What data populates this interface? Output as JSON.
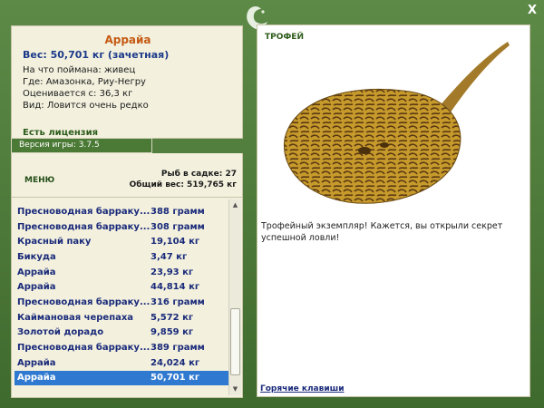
{
  "window": {
    "close_label": "X"
  },
  "fish": {
    "name": "Аррайа",
    "weight_line": "Вес: 50,701 кг (зачетная)",
    "caught_on": "На что поймана: живец",
    "location": "Где: Амазонка, Риу-Негру",
    "valued_from": "Оценивается с: 36,3 кг",
    "rarity": "Вид: Ловится очень редко"
  },
  "license": "Есть лицензия",
  "version": "Версия игры: 3.7.5",
  "menu_label": "МЕНЮ",
  "cage": {
    "count": "Рыб в садке: 27",
    "total_weight": "Общий вес: 519,765 кг"
  },
  "catch_list": [
    {
      "name": "Пресноводная барраку...",
      "weight": "388 грамм"
    },
    {
      "name": "Пресноводная барраку...",
      "weight": "308 грамм"
    },
    {
      "name": "Красный паку",
      "weight": "19,104 кг"
    },
    {
      "name": "Бикуда",
      "weight": "3,47 кг"
    },
    {
      "name": "Аррайа",
      "weight": "23,93 кг"
    },
    {
      "name": "Аррайа",
      "weight": "44,814 кг"
    },
    {
      "name": "Пресноводная барраку...",
      "weight": "316 грамм"
    },
    {
      "name": "Каймановая черепаха",
      "weight": "5,572 кг"
    },
    {
      "name": "Золотой дорадо",
      "weight": "9,859 кг"
    },
    {
      "name": "Пресноводная барраку...",
      "weight": "389 грамм"
    },
    {
      "name": "Аррайа",
      "weight": "24,024 кг"
    },
    {
      "name": "Аррайа",
      "weight": "50,701 кг",
      "selected": true
    }
  ],
  "trophy": {
    "label": "ТРОФЕЙ",
    "text": "Трофейный экземпляр! Кажется, вы открыли секрет успешной ловли!"
  },
  "hotkeys_label": "Горячие клавиши",
  "icons": {
    "close": "close-icon",
    "emblem": "fish-emblem-icon",
    "scroll_up": "scroll-up-icon",
    "scroll_down": "scroll-down-icon"
  },
  "colors": {
    "frame": "#4f7a3c",
    "panel": "#f3f1de",
    "title": "#c55a13",
    "selection": "#2f7ad0",
    "list_text": "#1a2a7a"
  }
}
